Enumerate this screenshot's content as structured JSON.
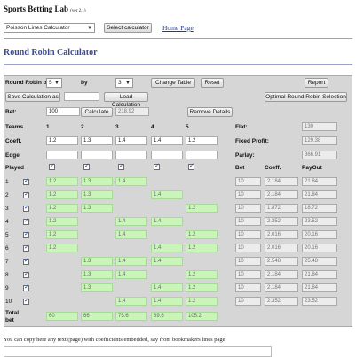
{
  "header": {
    "site_title": "Sports Betting Lab",
    "version": "(ver 2.1)"
  },
  "calculator_select": {
    "value": "Poisson Lines Calculator",
    "select_button": "Select calculator"
  },
  "home_link": "Home Page",
  "section_title": "Round Robin Calculator",
  "top_row": {
    "round_robin_label": "Round Robin of",
    "round_robin_value": "5",
    "by_label": "by",
    "by_value": "3",
    "change_table": "Change Table",
    "reset": "Reset",
    "report": "Report"
  },
  "second_row": {
    "save_calc": "Save Calculation as",
    "load_calc": "Load Calculation",
    "optimal": "Optimal Round Robin Selection"
  },
  "bet_row": {
    "label": "Bet:",
    "value": "100",
    "calculate": "Calculate",
    "result": "218.92",
    "remove_details": "Remove Details"
  },
  "teams_row": {
    "label": "Teams",
    "cols": [
      "1",
      "2",
      "3",
      "4",
      "5"
    ]
  },
  "coeff_row": {
    "label": "Coeff.",
    "values": [
      "1.2",
      "1.3",
      "1.4",
      "1.4",
      "1.2"
    ]
  },
  "edge_row": {
    "label": "Edge"
  },
  "summary": {
    "flat_label": "Flat:",
    "flat_value": "130",
    "fixed_profit_label": "Fixed Profit:",
    "fixed_profit_value": "129.38",
    "parlay_label": "Parlay:",
    "parlay_value": "366.91"
  },
  "played_row": {
    "label": "Played",
    "bet_col": "Bet",
    "coeff_col": "Coeff.",
    "payout_col": "PayOut"
  },
  "rows": [
    {
      "num": "1",
      "cells": [
        "1.2",
        "1.3",
        "1.4",
        "",
        ""
      ],
      "bet": "10",
      "coeff": "2.184",
      "payout": "21.84"
    },
    {
      "num": "2",
      "cells": [
        "1.2",
        "1.3",
        "",
        "1.4",
        ""
      ],
      "bet": "10",
      "coeff": "2.184",
      "payout": "21.84"
    },
    {
      "num": "3",
      "cells": [
        "1.2",
        "1.3",
        "",
        "",
        "1.2"
      ],
      "bet": "10",
      "coeff": "1.872",
      "payout": "18.72"
    },
    {
      "num": "4",
      "cells": [
        "1.2",
        "",
        "1.4",
        "1.4",
        ""
      ],
      "bet": "10",
      "coeff": "2.352",
      "payout": "23.52"
    },
    {
      "num": "5",
      "cells": [
        "1.2",
        "",
        "1.4",
        "",
        "1.2"
      ],
      "bet": "10",
      "coeff": "2.016",
      "payout": "20.16"
    },
    {
      "num": "6",
      "cells": [
        "1.2",
        "",
        "",
        "1.4",
        "1.2"
      ],
      "bet": "10",
      "coeff": "2.016",
      "payout": "20.16"
    },
    {
      "num": "7",
      "cells": [
        "",
        "1.3",
        "1.4",
        "1.4",
        ""
      ],
      "bet": "10",
      "coeff": "2.548",
      "payout": "25.48"
    },
    {
      "num": "8",
      "cells": [
        "",
        "1.3",
        "1.4",
        "",
        "1.2"
      ],
      "bet": "10",
      "coeff": "2.184",
      "payout": "21.84"
    },
    {
      "num": "9",
      "cells": [
        "",
        "1.3",
        "",
        "1.4",
        "1.2"
      ],
      "bet": "10",
      "coeff": "2.184",
      "payout": "21.84"
    },
    {
      "num": "10",
      "cells": [
        "",
        "",
        "1.4",
        "1.4",
        "1.2"
      ],
      "bet": "10",
      "coeff": "2.352",
      "payout": "23.52"
    }
  ],
  "total_row": {
    "label_line1": "Total",
    "label_line2": "bet",
    "values": [
      "60",
      "66",
      "75.6",
      "89.6",
      "105.2"
    ]
  },
  "footer_note": "You can copy here any text (page) with coefficients embedded, say from bookmakers lines page"
}
